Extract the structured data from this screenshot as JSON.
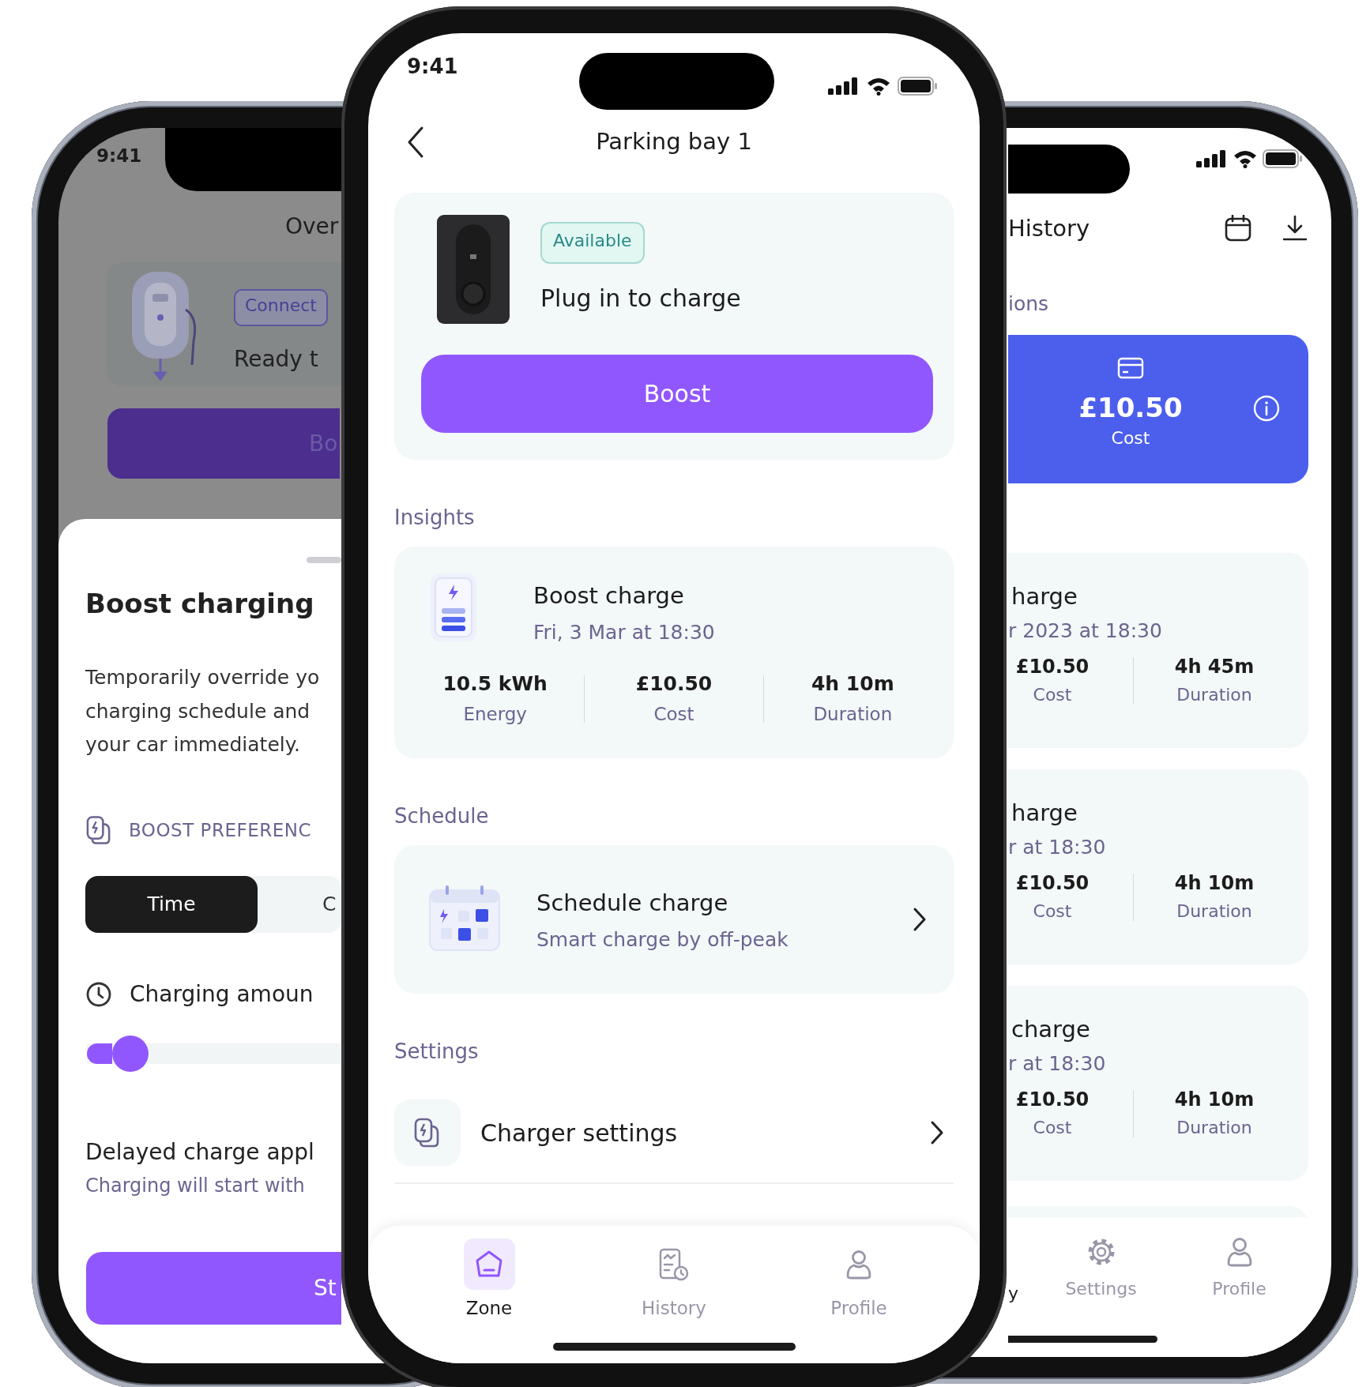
{
  "left_phone": {
    "status_time": "9:41",
    "backdrop": {
      "title": "Over",
      "badge": "Connect",
      "status": "Ready t",
      "button": "Bo"
    },
    "sheet": {
      "title": "Boost charging",
      "description": "Temporarily override yo\ncharging schedule and\nyour car immediately.",
      "preference_label": "BOOST PREFERENC",
      "segments": [
        {
          "label": "Time",
          "selected": true
        },
        {
          "label": "C",
          "selected": false
        }
      ],
      "amount_label": "Charging amoun",
      "slider": {
        "level": 0.17
      },
      "delay_title": "Delayed charge appl",
      "delay_text": "Charging will start with",
      "button": "St"
    }
  },
  "center_phone": {
    "status_time": "9:41",
    "title": "Parking bay 1",
    "charger": {
      "badge": "Available",
      "message": "Plug in to charge",
      "button": "Boost"
    },
    "insights": {
      "heading": "Insights",
      "title": "Boost charge",
      "subtitle": "Fri, 3 Mar at 18:30",
      "stats": [
        {
          "value": "10.5 kWh",
          "label": "Energy"
        },
        {
          "value": "£10.50",
          "label": "Cost"
        },
        {
          "value": "4h 10m",
          "label": "Duration"
        }
      ]
    },
    "schedule": {
      "heading": "Schedule",
      "title": "Schedule charge",
      "subtitle": "Smart charge by off-peak"
    },
    "settings": {
      "heading": "Settings",
      "items": [
        {
          "label": "Charger settings"
        }
      ]
    },
    "tabs": [
      {
        "kind": "home",
        "label": "Zone",
        "selected": true
      },
      {
        "kind": "history",
        "label": "History",
        "selected": false
      },
      {
        "kind": "profile",
        "label": "Profile",
        "selected": false
      }
    ]
  },
  "right_phone": {
    "title": "History",
    "subtitle": "ions",
    "summary": {
      "value": "£10.50",
      "label": "Cost"
    },
    "sessions": [
      {
        "title": "harge",
        "date": "r 2023 at 18:30",
        "stats": [
          {
            "value": "£10.50",
            "label": "Cost"
          },
          {
            "value": "4h 45m",
            "label": "Duration"
          }
        ]
      },
      {
        "title": "harge",
        "date": "r at 18:30",
        "stats": [
          {
            "value": "£10.50",
            "label": "Cost"
          },
          {
            "value": "4h 10m",
            "label": "Duration"
          }
        ]
      },
      {
        "title": "charge",
        "date": "r at 18:30",
        "stats": [
          {
            "value": "£10.50",
            "label": "Cost"
          },
          {
            "value": "4h 10m",
            "label": "Duration"
          }
        ]
      }
    ],
    "tabs": [
      {
        "label": "y",
        "selected": true
      },
      {
        "kind": "settings",
        "label": "Settings",
        "selected": false
      },
      {
        "kind": "profile",
        "label": "Profile",
        "selected": false
      }
    ]
  }
}
